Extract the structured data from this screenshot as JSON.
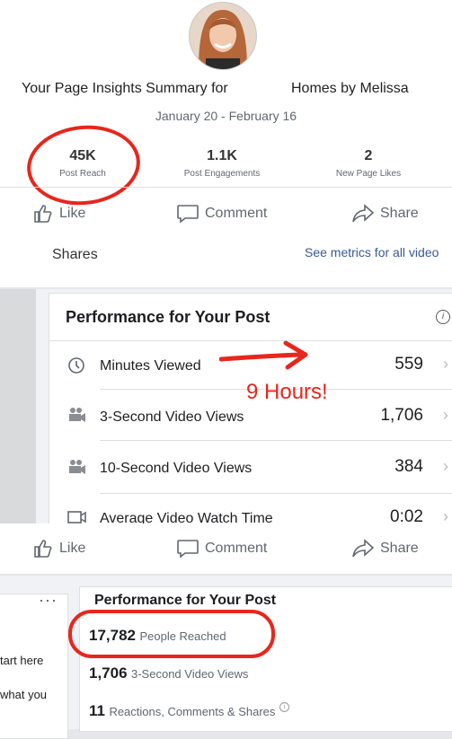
{
  "summary": {
    "title": "Your Page Insights Summary for",
    "page_name": "Homes by Melissa",
    "date_range": "January 20 - February 16",
    "metrics": [
      {
        "value": "45K",
        "label": "Post Reach"
      },
      {
        "value": "1.1K",
        "label": "Post Engagements"
      },
      {
        "value": "2",
        "label": "New Page Likes"
      }
    ]
  },
  "actions": {
    "like": "Like",
    "comment": "Comment",
    "share": "Share"
  },
  "shares_bar": {
    "label": "Shares",
    "see_metrics": "See metrics for all video"
  },
  "performance": {
    "title": "Performance for Your Post",
    "rows": [
      {
        "icon": "clock-icon",
        "label": "Minutes Viewed",
        "value": "559"
      },
      {
        "icon": "video-camera-icon",
        "label": "3-Second Video Views",
        "value": "1,706"
      },
      {
        "icon": "video-camera-icon",
        "label": "10-Second Video Views",
        "value": "384"
      },
      {
        "icon": "video-clip-icon",
        "label": "Average Video Watch Time",
        "value": "0:02"
      }
    ],
    "annotation": "9 Hours!"
  },
  "left_card": {
    "line1": "tart here",
    "line2": "what you"
  },
  "performance2": {
    "title": "Performance for Your Post",
    "rows": [
      {
        "value": "17,782",
        "label": "People Reached"
      },
      {
        "value": "1,706",
        "label": "3-Second Video Views"
      },
      {
        "value": "11",
        "label": "Reactions, Comments & Shares"
      }
    ]
  },
  "colors": {
    "annotation_red": "#e8261c",
    "link_blue": "#385898"
  }
}
